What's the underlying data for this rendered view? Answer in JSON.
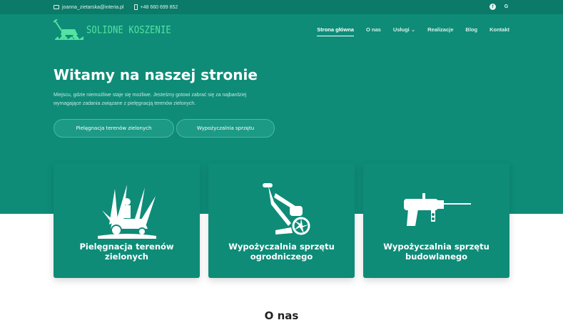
{
  "topbar": {
    "email": "joanna_zietarska@interia.pl",
    "phone": "+48 660 699 852",
    "social": [
      {
        "icon": "facebook-icon",
        "label": "f"
      },
      {
        "icon": "google-icon",
        "label": "G"
      }
    ]
  },
  "brand": {
    "name": "SOLIDNE KOSZENIE",
    "icon": "lawn-mower-icon"
  },
  "menu": {
    "home": "Strona główna",
    "about": "O nas",
    "services": "Usługi",
    "services_chevron": "⌄",
    "projects": "Realizacje",
    "blog": "Blog",
    "contact": "Kontakt"
  },
  "hero": {
    "title": "Witamy na naszej stronie",
    "text": "Miejscu, gdzie niemożliwe staje się możliwe. Jesteśmy gotowi zabrać się za najbardziej wymagające zadania związane z pielęgnacją terenów zielonych.",
    "button1": "Pielęgnacja terenów zielonych",
    "button2": "Wypożyczalnia sprzętu"
  },
  "cards": [
    {
      "title": "Pielęgnacja terenów zielonych",
      "icon": "riding-mower-icon"
    },
    {
      "title": "Wypożyczalnia sprzętu ogrodniczego",
      "icon": "tiller-icon"
    },
    {
      "title": "Wypożyczalnia sprzętu budowlanego",
      "icon": "drill-icon"
    }
  ],
  "about": {
    "title": "O nas"
  },
  "colors": {
    "primary": "#0e8c78",
    "topbar": "#0b7a68",
    "logo": "#54e3a0"
  }
}
